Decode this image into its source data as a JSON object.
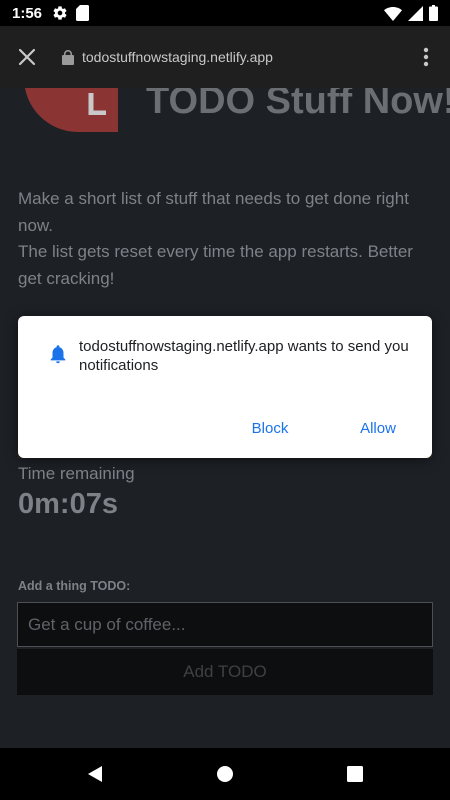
{
  "status_bar": {
    "time": "1:56",
    "icons": [
      "settings-icon",
      "sd-card-icon",
      "wifi-icon",
      "signal-icon",
      "battery-icon"
    ]
  },
  "browser": {
    "url": "todostuffnowstaging.netlify.app",
    "close_icon": "close-icon",
    "lock_icon": "lock-icon",
    "menu_icon": "more-vert-icon"
  },
  "page": {
    "app_title": "TODO Stuff Now!",
    "intro_line1": "Make a short list of stuff that needs to get done right now.",
    "intro_line2": "The list gets reset every time the app restarts. Better get cracking!",
    "time_remaining_label": "Time remaining",
    "time_remaining_value": "0m:07s",
    "add_label": "Add a thing TODO:",
    "input_placeholder": "Get a cup of coffee...",
    "add_button": "Add TODO"
  },
  "dialog": {
    "icon": "bell-icon",
    "message": "todostuffnowstaging.netlify.app wants to send you notifications",
    "block": "Block",
    "allow": "Allow"
  },
  "colors": {
    "accent": "#1a73e8",
    "page_bg": "#1d2126",
    "toolbar_bg": "#1f1f1f",
    "logo_red": "#8a3433"
  }
}
